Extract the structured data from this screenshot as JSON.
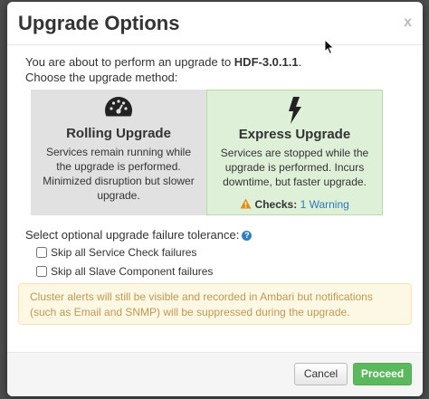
{
  "dialog": {
    "title": "Upgrade Options",
    "close_label": "x"
  },
  "intro": {
    "line1_prefix": "You are about to perform an upgrade to ",
    "target_version": "HDF-3.0.1.1",
    "line1_suffix": ".",
    "line2": "Choose the upgrade method:"
  },
  "methods": {
    "rolling": {
      "icon": "speedometer-icon",
      "title": "Rolling Upgrade",
      "description": "Services remain running while the upgrade is performed. Minimized disruption but slower upgrade."
    },
    "express": {
      "icon": "lightning-bolt-icon",
      "title": "Express Upgrade",
      "description": "Services are stopped while the upgrade is performed. Incurs downtime, but faster upgrade.",
      "checks_label": "Checks:",
      "checks_value": "1 Warning"
    }
  },
  "tolerance": {
    "label": "Select optional upgrade failure tolerance:",
    "options": [
      {
        "label": "Skip all Service Check failures",
        "checked": false
      },
      {
        "label": "Skip all Slave Component failures",
        "checked": false
      }
    ]
  },
  "alert_text": "Cluster alerts will still be visible and recorded in Ambari but notifications (such as Email and SNMP) will be suppressed during the upgrade.",
  "footer": {
    "cancel_label": "Cancel",
    "proceed_label": "Proceed"
  },
  "colors": {
    "express_bg": "#dff0d8",
    "rolling_bg": "#e1e1e1",
    "proceed": "#5cb85c",
    "warning": "#e38d13",
    "link": "#2a7ab8"
  }
}
